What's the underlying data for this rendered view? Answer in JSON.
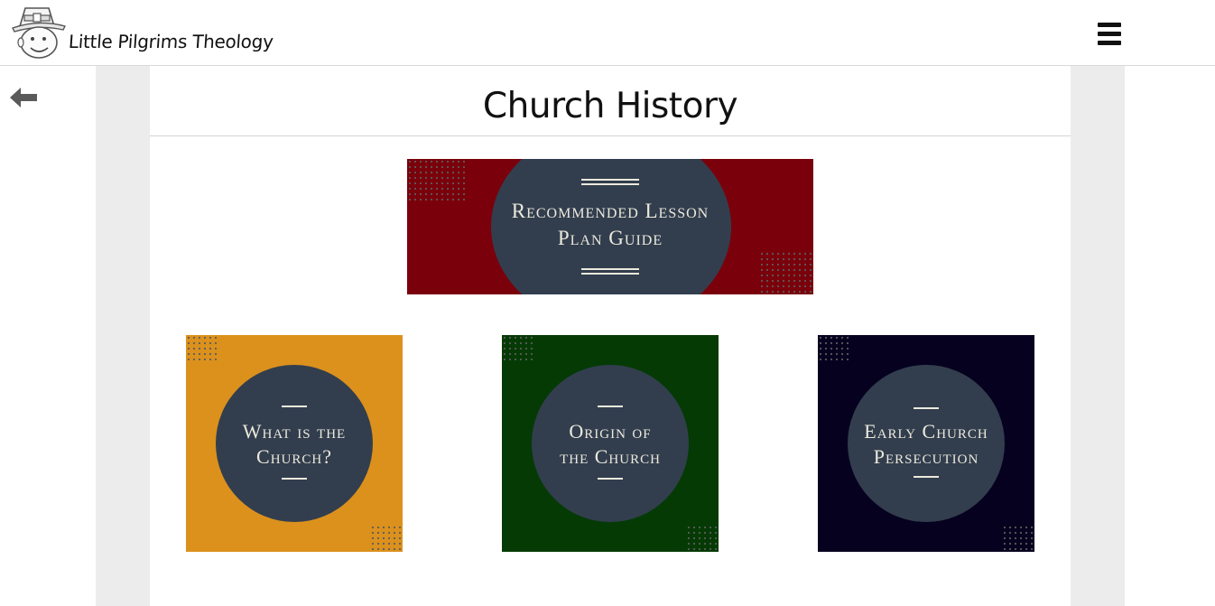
{
  "header": {
    "site_title": "Little Pilgrims Theology",
    "logo_icon": "pilgrim-boy-logo",
    "menu_icon": "hamburger-menu-icon"
  },
  "nav": {
    "back_icon": "arrow-left-icon"
  },
  "page": {
    "title": "Church History"
  },
  "cards": [
    {
      "line1": "Recommended Lesson",
      "line2": "Plan Guide",
      "background": "#7a000b",
      "circle": "#323e4e"
    },
    {
      "line1": "What is the",
      "line2": "Church?",
      "background": "#dc911d",
      "circle": "#323e4e"
    },
    {
      "line1": "Origin of",
      "line2": "the Church",
      "background": "#053a05",
      "circle": "#323e4e"
    },
    {
      "line1": "Early Church",
      "line2": "Persecution",
      "background": "#06011f",
      "circle": "#323e4e"
    }
  ],
  "colors": {
    "gutter": "#ececec",
    "panel": "#ffffff",
    "card_text": "#ece9dc",
    "dot_pattern": "#5b5b5b"
  }
}
